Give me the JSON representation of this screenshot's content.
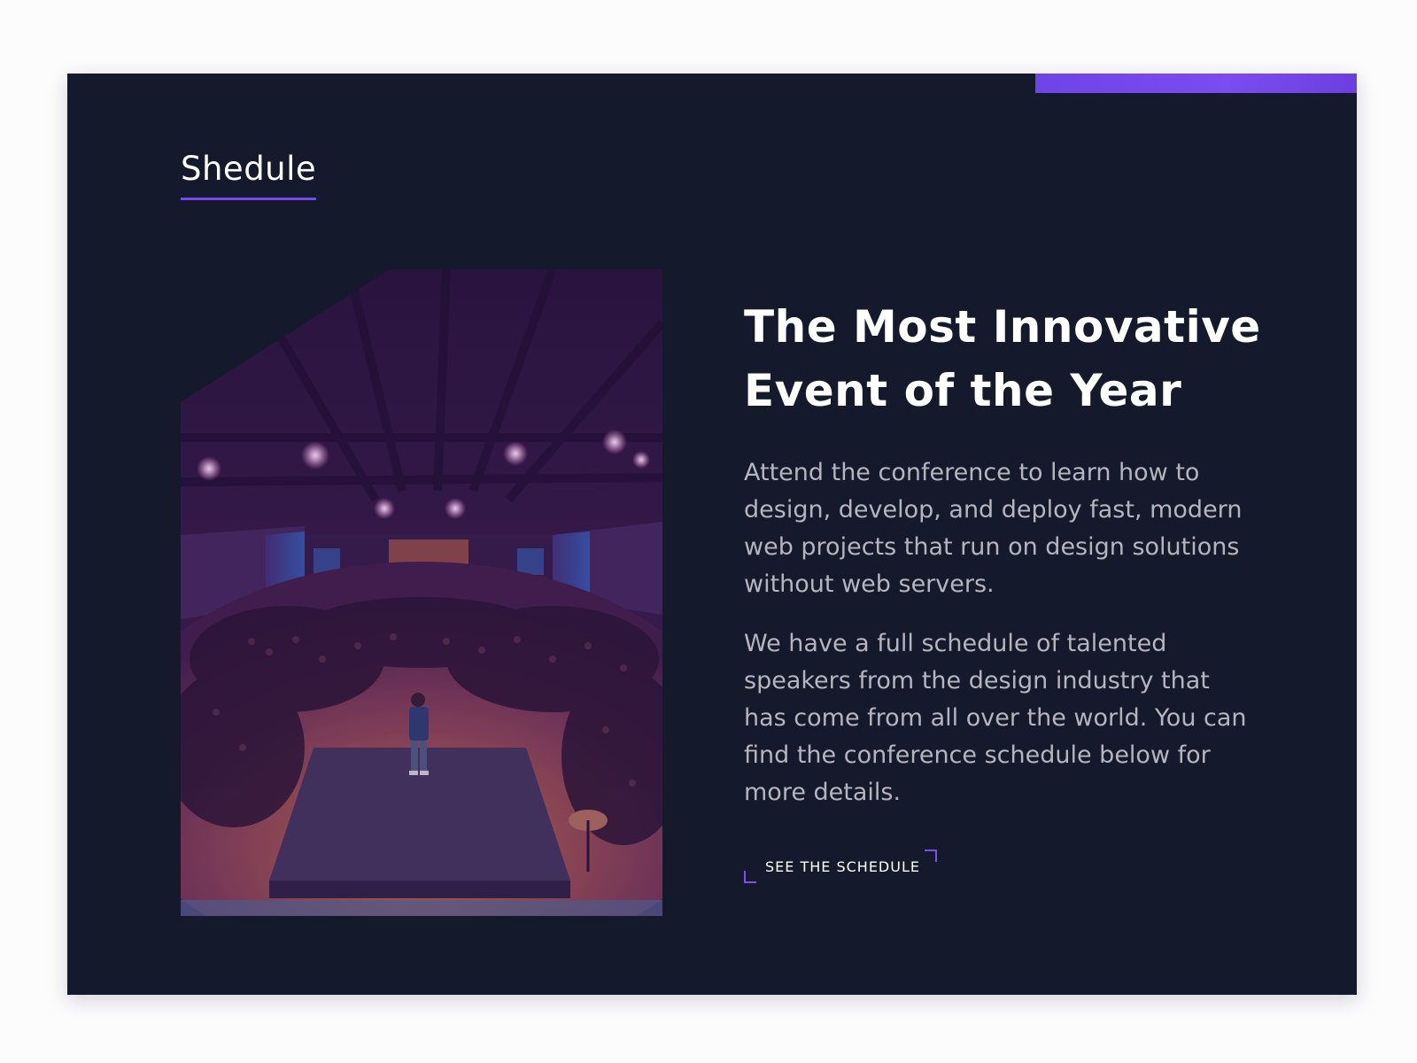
{
  "section": {
    "title": "Shedule"
  },
  "hero": {
    "image_alt": "Speaker on stage in front of a large conference audience",
    "headline": "The Most Innovative Event of the Year",
    "paragraphs": [
      "Attend the conference to learn how to design, develop, and deploy fast, modern web projects that run on design solutions without web servers.",
      "We have a full schedule of talented speakers from the design industry that has come from all over the world. You can find the conference schedule below for more details."
    ],
    "cta_label": "SEE THE SCHEDULE"
  },
  "colors": {
    "background": "#141a2b",
    "accent": "#6d4aee",
    "text": "#ffffff",
    "muted_text": "#b6b4bd"
  }
}
